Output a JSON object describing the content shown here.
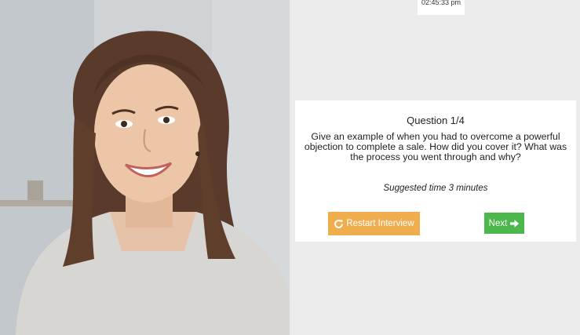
{
  "timer": {
    "text": "02:45:33 pm"
  },
  "question": {
    "number_label": "Question 1/4",
    "text": "Give an example of when you had to overcome a powerful objection to complete a sale. How did you cover it? What was the process you went through and why?",
    "suggested_time": "Suggested time 3 minutes"
  },
  "buttons": {
    "restart_label": "Restart Interview",
    "next_label": "Next"
  },
  "icons": {
    "restart": "refresh-icon",
    "next": "arrow-right-icon"
  },
  "colors": {
    "restart_button": "#f0ad4e",
    "next_button": "#4cb84c",
    "panel_background": "#ebebeb",
    "card_background": "#ffffff"
  }
}
